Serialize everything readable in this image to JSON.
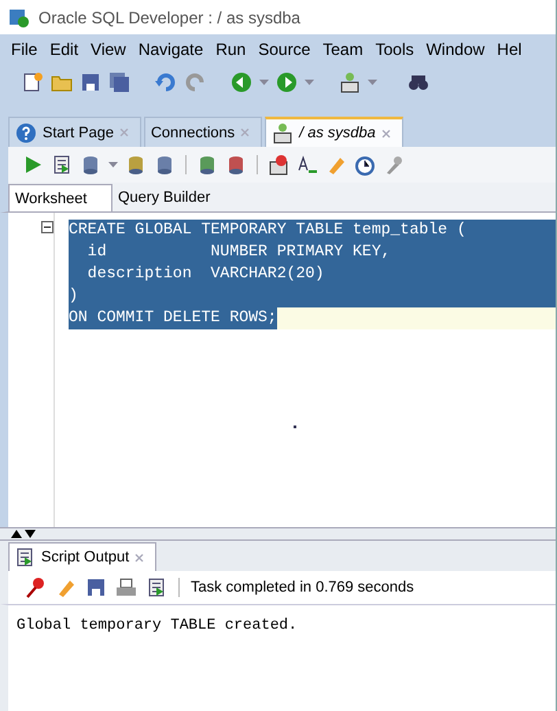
{
  "window": {
    "title": "Oracle SQL Developer : / as sysdba"
  },
  "menu": [
    "File",
    "Edit",
    "View",
    "Navigate",
    "Run",
    "Source",
    "Team",
    "Tools",
    "Window",
    "Hel"
  ],
  "editor_tabs": [
    {
      "label": "Start Page",
      "selected": false
    },
    {
      "label": "Connections",
      "selected": false
    },
    {
      "label": "/ as sysdba",
      "selected": true
    }
  ],
  "sub_tabs": [
    {
      "label": "Worksheet",
      "selected": true
    },
    {
      "label": "Query Builder",
      "selected": false
    }
  ],
  "code_lines": [
    {
      "text": "CREATE GLOBAL TEMPORARY TABLE temp_table (",
      "selected": true,
      "current": false
    },
    {
      "text": "  id           NUMBER PRIMARY KEY,",
      "selected": true,
      "current": false
    },
    {
      "text": "  description  VARCHAR2(20)",
      "selected": true,
      "current": false
    },
    {
      "text": ")",
      "selected": true,
      "current": false
    },
    {
      "text": "ON COMMIT DELETE ROWS;",
      "selected": true,
      "current": true
    }
  ],
  "output_panel": {
    "tab": "Script Output",
    "status": "Task completed in 0.769 seconds",
    "text": "Global temporary TABLE created."
  }
}
